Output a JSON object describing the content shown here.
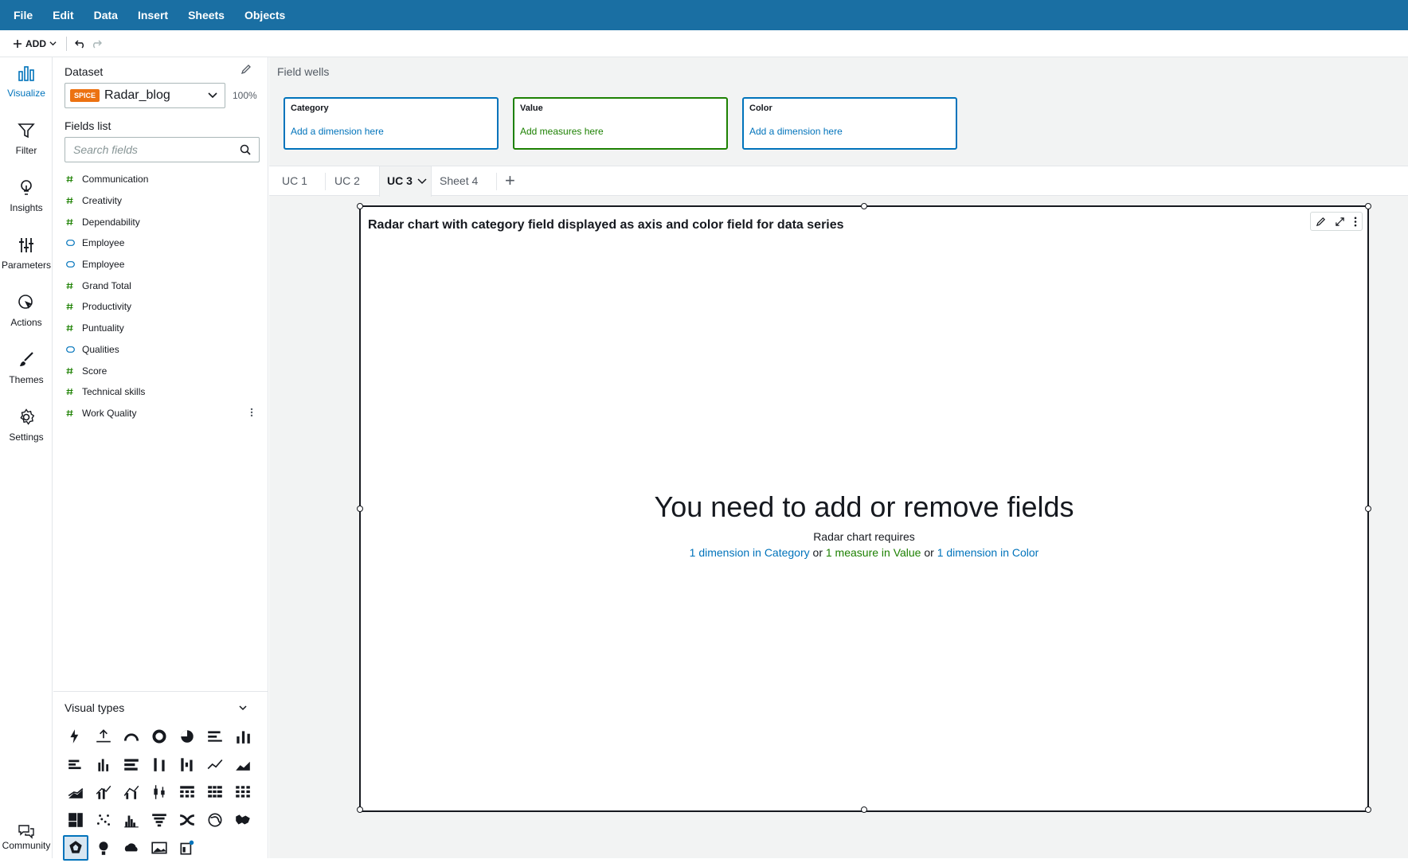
{
  "menu": [
    "File",
    "Edit",
    "Data",
    "Insert",
    "Sheets",
    "Objects"
  ],
  "toolbar": {
    "add_label": "ADD"
  },
  "rail": {
    "items": [
      {
        "label": "Visualize",
        "icon": "bar-chart-icon",
        "active": true
      },
      {
        "label": "Filter",
        "icon": "filter-icon"
      },
      {
        "label": "Insights",
        "icon": "lightbulb-icon"
      },
      {
        "label": "Parameters",
        "icon": "sliders-icon"
      },
      {
        "label": "Actions",
        "icon": "cursor-click-icon"
      },
      {
        "label": "Themes",
        "icon": "brush-icon"
      },
      {
        "label": "Settings",
        "icon": "gear-icon"
      }
    ],
    "community": "Community"
  },
  "dataset": {
    "title": "Dataset",
    "badge": "SPICE",
    "name": "Radar_blog",
    "percent": "100%"
  },
  "fields": {
    "title": "Fields list",
    "search_placeholder": "Search fields",
    "items": [
      {
        "name": "Communication",
        "type": "measure"
      },
      {
        "name": "Creativity",
        "type": "measure"
      },
      {
        "name": "Dependability",
        "type": "measure"
      },
      {
        "name": "Employee",
        "type": "dimension"
      },
      {
        "name": "Employee",
        "type": "dimension"
      },
      {
        "name": "Grand Total",
        "type": "measure"
      },
      {
        "name": "Productivity",
        "type": "measure"
      },
      {
        "name": "Puntuality",
        "type": "measure"
      },
      {
        "name": "Qualities",
        "type": "dimension"
      },
      {
        "name": "Score",
        "type": "measure"
      },
      {
        "name": "Technical skills",
        "type": "measure"
      },
      {
        "name": "Work Quality",
        "type": "measure"
      }
    ]
  },
  "visual_types": {
    "title": "Visual types"
  },
  "field_wells": {
    "title": "Field wells",
    "wells": [
      {
        "label": "Category",
        "placeholder": "Add a dimension here"
      },
      {
        "label": "Value",
        "placeholder": "Add measures here"
      },
      {
        "label": "Color",
        "placeholder": "Add a dimension here"
      }
    ]
  },
  "tabs": [
    "UC 1",
    "UC 2",
    "UC 3",
    "Sheet 4"
  ],
  "visual": {
    "title": "Radar chart with category field displayed as axis and color field for data series",
    "message": "You need to add or remove fields",
    "requires": "Radar chart requires",
    "req1": "1 dimension in Category",
    "or": "or",
    "req2": "1 measure in Value",
    "req3": "1 dimension in Color"
  },
  "colors": {
    "menubar": "#1a6fa3",
    "dimension": "#0073bb",
    "measure": "#1d8102",
    "spice": "#ec7211"
  }
}
